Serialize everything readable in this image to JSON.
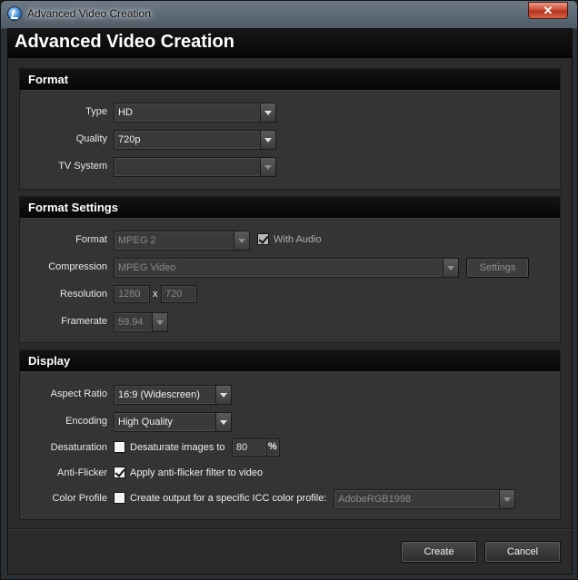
{
  "window": {
    "title": "Advanced Video Creation",
    "close_glyph": "✕"
  },
  "header": {
    "title": "Advanced Video Creation"
  },
  "format": {
    "section_title": "Format",
    "type": {
      "label": "Type",
      "value": "HD"
    },
    "quality": {
      "label": "Quality",
      "value": "720p"
    },
    "tv_system": {
      "label": "TV System",
      "value": ""
    }
  },
  "format_settings": {
    "section_title": "Format Settings",
    "format": {
      "label": "Format",
      "value": "MPEG 2"
    },
    "with_audio": {
      "label": "With Audio",
      "checked": true
    },
    "compression": {
      "label": "Compression",
      "value": "MPEG Video"
    },
    "settings_button": "Settings",
    "resolution": {
      "label": "Resolution",
      "width": "1280",
      "separator": "x",
      "height": "720"
    },
    "framerate": {
      "label": "Framerate",
      "value": "59.94"
    }
  },
  "display": {
    "section_title": "Display",
    "aspect_ratio": {
      "label": "Aspect Ratio",
      "value": "16:9 (Widescreen)"
    },
    "encoding": {
      "label": "Encoding",
      "value": "High Quality"
    },
    "desaturation": {
      "label": "Desaturation",
      "checkbox_label": "Desaturate images to",
      "checked": false,
      "value": "80",
      "unit": "%"
    },
    "anti_flicker": {
      "label": "Anti-Flicker",
      "checkbox_label": "Apply anti-flicker filter to video",
      "checked": true
    },
    "color_profile": {
      "label": "Color Profile",
      "checkbox_label": "Create output for a specific ICC color profile:",
      "checked": false,
      "value": "AdobeRGB1998"
    }
  },
  "buttons": {
    "create": "Create",
    "cancel": "Cancel"
  },
  "icons": {
    "app": "app-logo-icon",
    "close": "close-icon",
    "dropdown": "chevron-down-icon",
    "check": "checkmark-icon"
  },
  "colors": {
    "background": "#2b2b2b",
    "header": "#050505",
    "panel": "#343434",
    "close_button": "#c7452f"
  }
}
